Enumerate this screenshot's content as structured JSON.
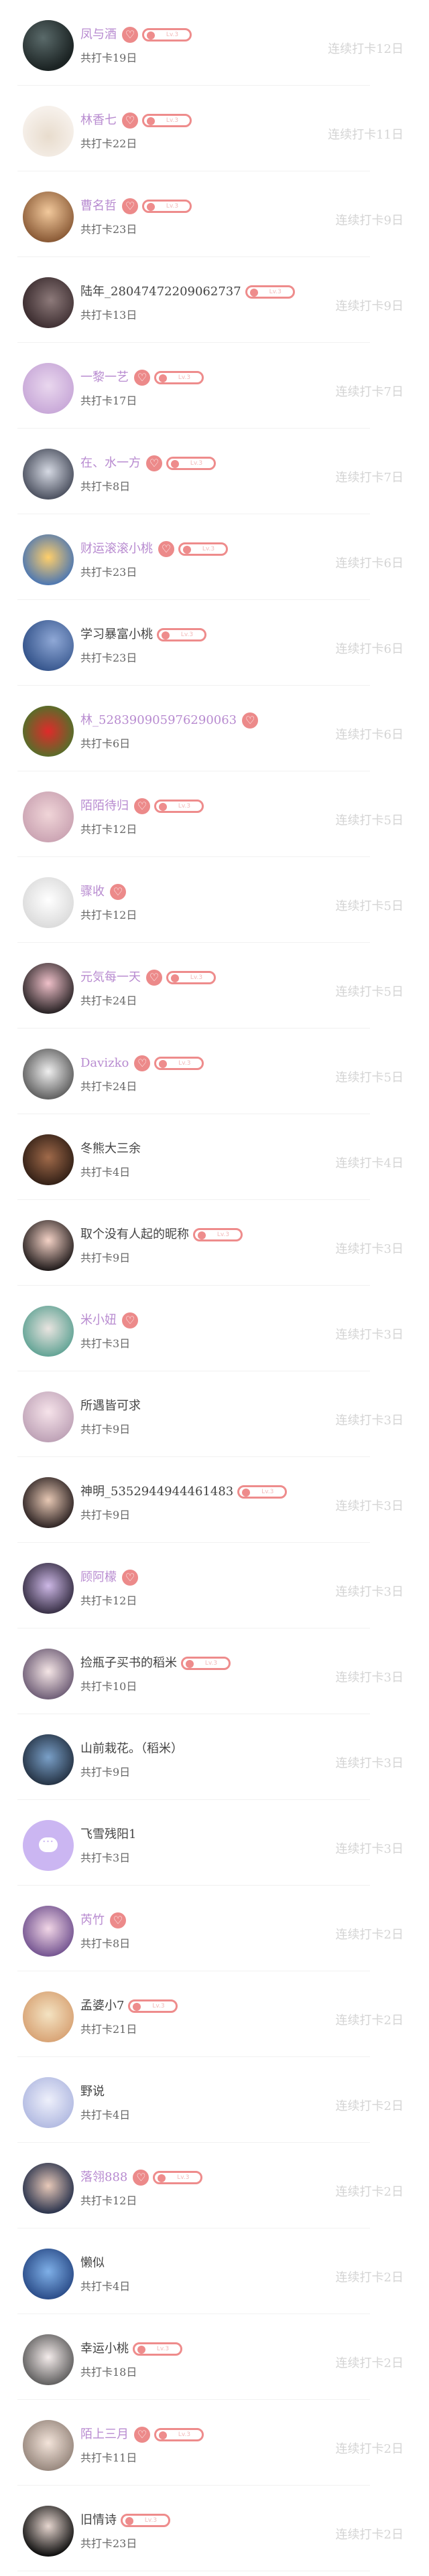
{
  "rows": [
    {
      "name": "凤与酒",
      "vip": true,
      "heart": true,
      "level": true,
      "level_text": "Lv.3",
      "total": "共打卡19日",
      "streak": "连续打卡12日"
    },
    {
      "name": "林香七",
      "vip": true,
      "heart": true,
      "level": true,
      "level_text": "Lv.3",
      "total": "共打卡22日",
      "streak": "连续打卡11日"
    },
    {
      "name": "曹名哲",
      "vip": true,
      "heart": true,
      "level": true,
      "level_text": "Lv.3",
      "total": "共打卡23日",
      "streak": "连续打卡9日"
    },
    {
      "name": "陆年_28047472209062737",
      "vip": false,
      "heart": false,
      "level": true,
      "level_text": "Lv.3",
      "total": "共打卡13日",
      "streak": "连续打卡9日"
    },
    {
      "name": "一黎一艺",
      "vip": true,
      "heart": true,
      "level": true,
      "level_text": "Lv.3",
      "total": "共打卡17日",
      "streak": "连续打卡7日"
    },
    {
      "name": "在、水一方",
      "vip": true,
      "heart": true,
      "level": true,
      "level_text": "Lv.3",
      "total": "共打卡8日",
      "streak": "连续打卡7日"
    },
    {
      "name": "财运滚滚小桃",
      "vip": true,
      "heart": true,
      "level": true,
      "level_text": "Lv.3",
      "total": "共打卡23日",
      "streak": "连续打卡6日"
    },
    {
      "name": "学习暴富小桃",
      "vip": false,
      "heart": false,
      "level": true,
      "level_text": "Lv.3",
      "total": "共打卡23日",
      "streak": "连续打卡6日"
    },
    {
      "name": "林_528390905976290063",
      "vip": true,
      "heart": true,
      "level": false,
      "level_text": "",
      "total": "共打卡6日",
      "streak": "连续打卡6日"
    },
    {
      "name": "陌陌待归",
      "vip": true,
      "heart": true,
      "level": true,
      "level_text": "Lv.3",
      "total": "共打卡12日",
      "streak": "连续打卡5日"
    },
    {
      "name": "骤收",
      "vip": true,
      "heart": true,
      "level": false,
      "level_text": "",
      "total": "共打卡12日",
      "streak": "连续打卡5日"
    },
    {
      "name": "元気每一天",
      "vip": true,
      "heart": true,
      "level": true,
      "level_text": "Lv.3",
      "total": "共打卡24日",
      "streak": "连续打卡5日"
    },
    {
      "name": "Davizko",
      "vip": true,
      "heart": true,
      "level": true,
      "level_text": "Lv.3",
      "total": "共打卡24日",
      "streak": "连续打卡5日"
    },
    {
      "name": "冬熊大三余",
      "vip": false,
      "heart": false,
      "level": false,
      "level_text": "",
      "total": "共打卡4日",
      "streak": "连续打卡4日"
    },
    {
      "name": "取个没有人起的昵称",
      "vip": false,
      "heart": false,
      "level": true,
      "level_text": "Lv.3",
      "total": "共打卡9日",
      "streak": "连续打卡3日"
    },
    {
      "name": "米小妞",
      "vip": true,
      "heart": true,
      "level": false,
      "level_text": "",
      "total": "共打卡3日",
      "streak": "连续打卡3日"
    },
    {
      "name": "所遇皆可求",
      "vip": false,
      "heart": false,
      "level": false,
      "level_text": "",
      "total": "共打卡9日",
      "streak": "连续打卡3日"
    },
    {
      "name": "神明_5352944944461483",
      "vip": false,
      "heart": false,
      "level": true,
      "level_text": "Lv.3",
      "total": "共打卡9日",
      "streak": "连续打卡3日"
    },
    {
      "name": "顾阿檬",
      "vip": true,
      "heart": true,
      "level": false,
      "level_text": "",
      "total": "共打卡12日",
      "streak": "连续打卡3日"
    },
    {
      "name": "捡瓶子买书的稻米",
      "vip": false,
      "heart": false,
      "level": true,
      "level_text": "Lv.3",
      "total": "共打卡10日",
      "streak": "连续打卡3日"
    },
    {
      "name": "山前栽花。（稻米）",
      "vip": false,
      "heart": false,
      "level": false,
      "level_text": "",
      "total": "共打卡9日",
      "streak": "连续打卡3日"
    },
    {
      "name": "飞雪残阳1",
      "vip": false,
      "heart": false,
      "level": false,
      "level_text": "",
      "total": "共打卡3日",
      "streak": "连续打卡3日"
    },
    {
      "name": "芮竹",
      "vip": true,
      "heart": true,
      "level": false,
      "level_text": "",
      "total": "共打卡8日",
      "streak": "连续打卡2日"
    },
    {
      "name": "孟婆小7",
      "vip": false,
      "heart": false,
      "level": true,
      "level_text": "Lv.3",
      "total": "共打卡21日",
      "streak": "连续打卡2日"
    },
    {
      "name": "野说",
      "vip": false,
      "heart": false,
      "level": false,
      "level_text": "",
      "total": "共打卡4日",
      "streak": "连续打卡2日"
    },
    {
      "name": "落翎888",
      "vip": true,
      "heart": true,
      "level": true,
      "level_text": "Lv.3",
      "total": "共打卡12日",
      "streak": "连续打卡2日"
    },
    {
      "name": "懒似",
      "vip": false,
      "heart": false,
      "level": false,
      "level_text": "",
      "total": "共打卡4日",
      "streak": "连续打卡2日"
    },
    {
      "name": "幸运小桃",
      "vip": false,
      "heart": false,
      "level": true,
      "level_text": "Lv.3",
      "total": "共打卡18日",
      "streak": "连续打卡2日"
    },
    {
      "name": "陌上三月",
      "vip": true,
      "heart": true,
      "level": true,
      "level_text": "Lv.3",
      "total": "共打卡11日",
      "streak": "连续打卡2日"
    },
    {
      "name": "旧情诗",
      "vip": false,
      "heart": false,
      "level": true,
      "level_text": "Lv.3",
      "total": "共打卡23日",
      "streak": "连续打卡2日"
    }
  ],
  "colors": {
    "vip_name": "#b88bd0",
    "badge": "#ec8a8a",
    "streak": "#d4d4d4"
  }
}
